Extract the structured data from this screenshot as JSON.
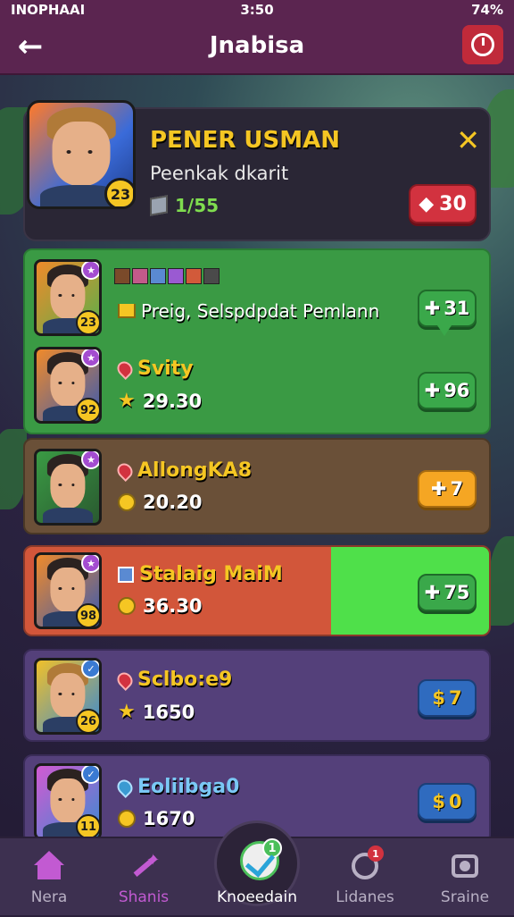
{
  "status": {
    "left": "INOPHAAI",
    "time": "3:50",
    "battery": "74%"
  },
  "header": {
    "title": "Jnabisa",
    "back_icon": "arrow-left-icon",
    "power_icon": "power-icon"
  },
  "profile": {
    "name": "PENER USMAN",
    "subtitle": "Peenkak dkarit",
    "level": "23",
    "gems": "1/55",
    "close": "✕",
    "action_value": "30"
  },
  "rows": [
    {
      "title": "Preig, Selspdpdat Pemlann",
      "name": "",
      "score": "",
      "level": "23",
      "button": "31",
      "color": "green"
    },
    {
      "title": "",
      "name": "Svity",
      "score": "29.30",
      "level": "92",
      "button": "96",
      "color": "green"
    },
    {
      "title": "",
      "name": "AllongKA8",
      "score": "20.20",
      "level": "",
      "button": "7",
      "color": "orange"
    },
    {
      "title": "",
      "name": "Stalaig MaiM",
      "score": "36.30",
      "level": "98",
      "button": "75",
      "color": "green"
    },
    {
      "title": "",
      "name": "Sclbo:e9",
      "score": "1650",
      "level": "26",
      "button": "7",
      "color": "blue"
    },
    {
      "title": "",
      "name": "Eoliibga0",
      "score": "1670",
      "level": "11",
      "button": "0",
      "color": "blue"
    }
  ],
  "nav": {
    "items": [
      {
        "label": "Nera",
        "icon": "home-icon"
      },
      {
        "label": "Shanis",
        "icon": "wand-icon"
      },
      {
        "label": "Knoeedain",
        "icon": "check-icon",
        "badge": "1"
      },
      {
        "label": "Lidanes",
        "icon": "target-icon",
        "badge": "1"
      },
      {
        "label": "Sraine",
        "icon": "camera-icon"
      }
    ]
  }
}
